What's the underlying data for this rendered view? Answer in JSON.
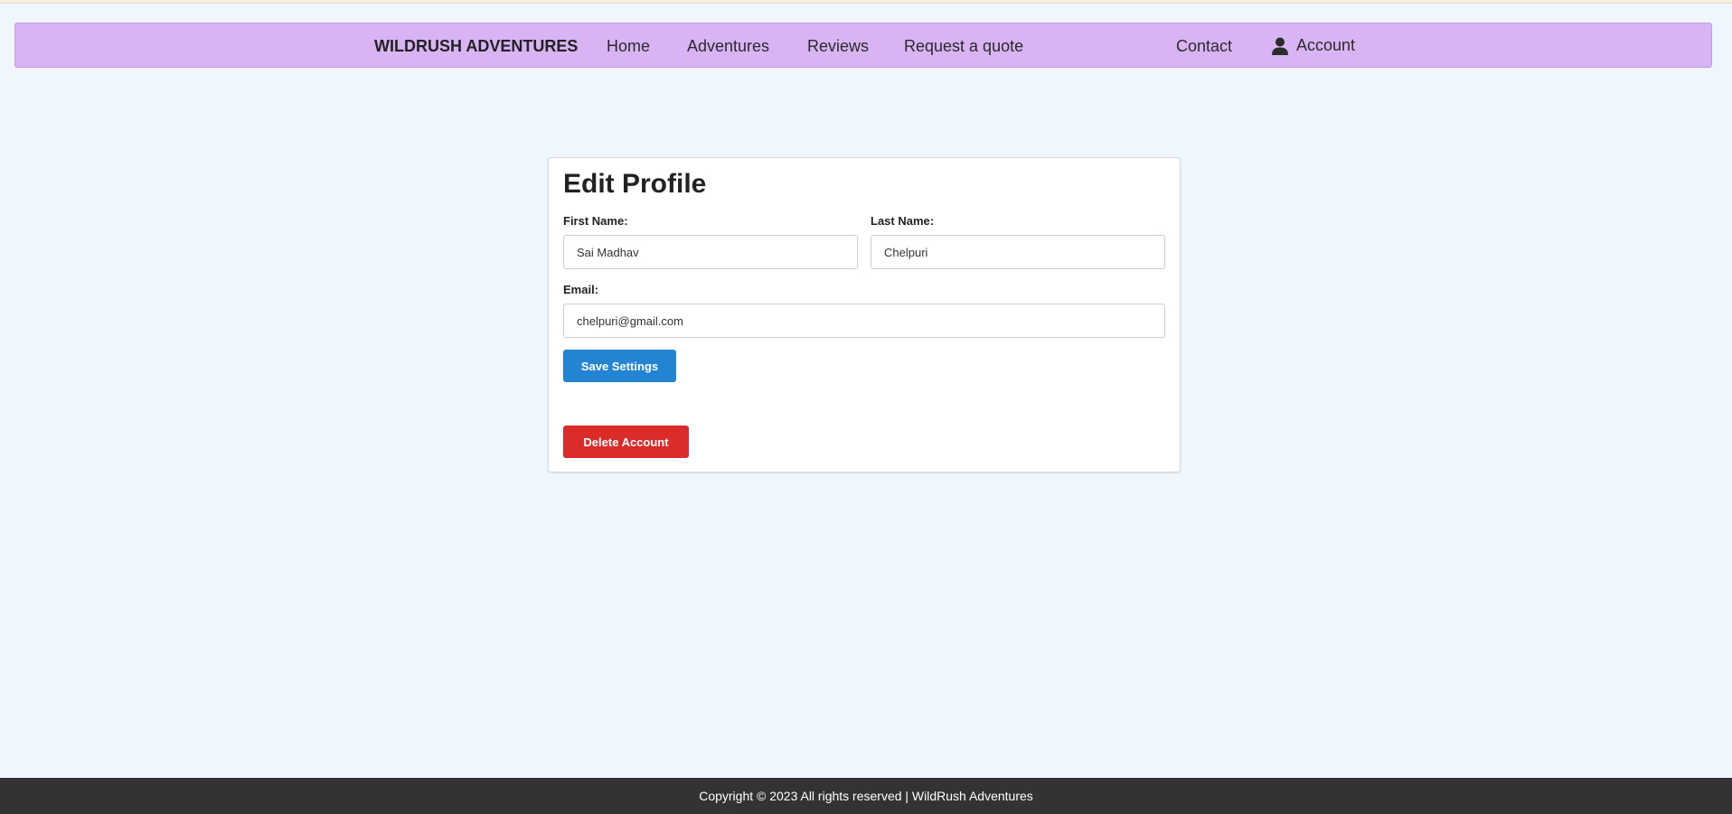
{
  "nav": {
    "brand": "WILDRUSH ADVENTURES",
    "links": [
      "Home",
      "Adventures",
      "Reviews",
      "Request a quote"
    ],
    "contact": "Contact",
    "account": "Account",
    "account_icon": "user-icon"
  },
  "form": {
    "title": "Edit Profile",
    "first_name_label": "First Name:",
    "first_name_value": "Sai Madhav",
    "last_name_label": "Last Name:",
    "last_name_value": "Chelpuri",
    "email_label": "Email:",
    "email_value": "chelpuri@gmail.com",
    "save_label": "Save Settings",
    "delete_label": "Delete Account"
  },
  "footer": {
    "text": "Copyright © 2023 All rights reserved | WildRush Adventures"
  },
  "colors": {
    "navbar_bg": "#d8b4f5",
    "page_bg": "#eff6fe",
    "save_button": "#2484d4",
    "delete_button": "#dc2b2b",
    "footer_bg": "#333333"
  }
}
